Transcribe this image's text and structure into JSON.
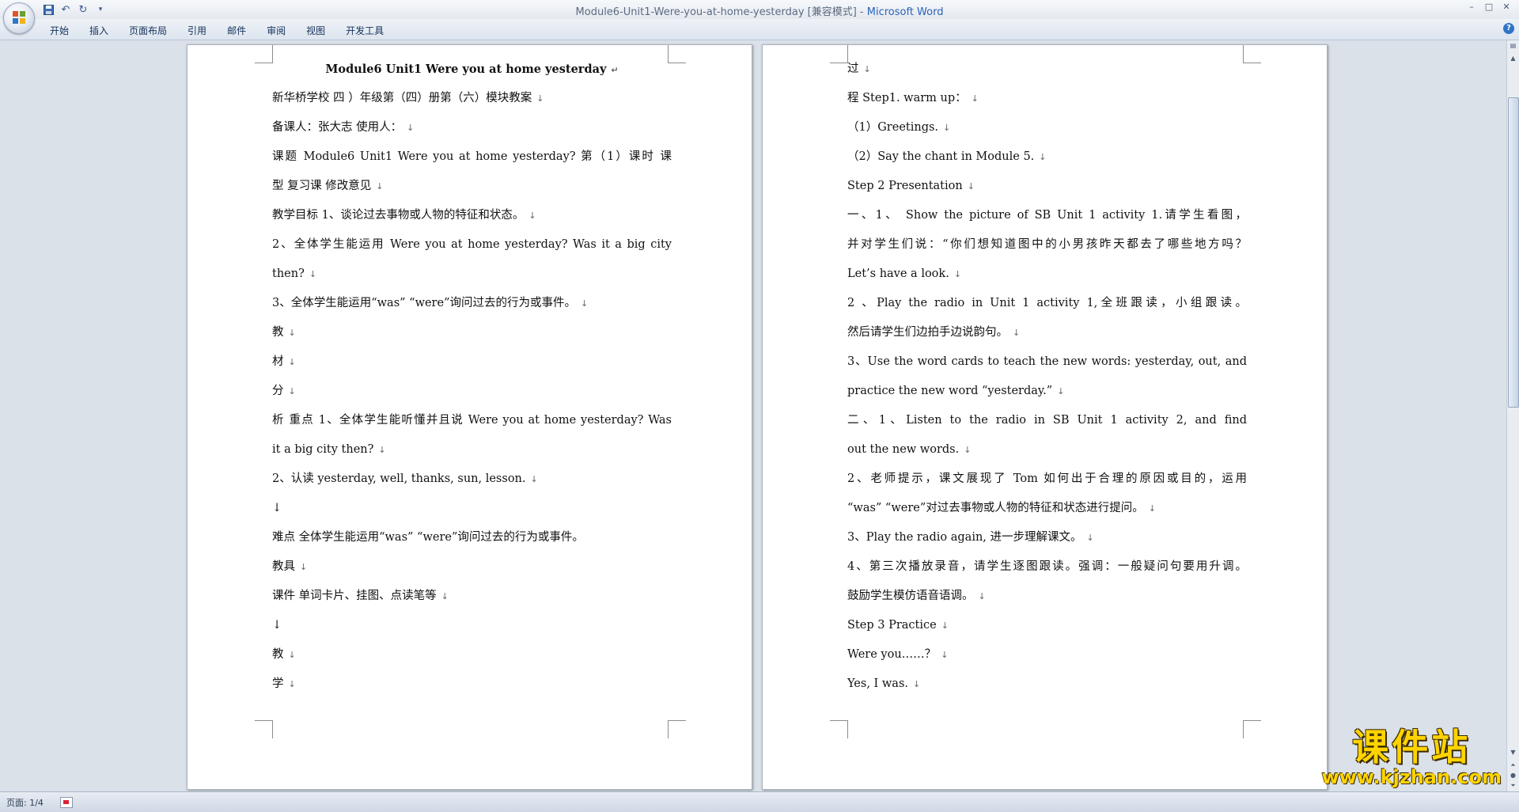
{
  "window": {
    "title": "Module6-Unit1-Were-you-at-home-yesterday [兼容模式] - ",
    "app_name": "Microsoft Word",
    "controls": [
      "–",
      "□",
      "✕"
    ]
  },
  "ribbon": {
    "tabs": [
      "开始",
      "插入",
      "页面布局",
      "引用",
      "邮件",
      "审阅",
      "视图",
      "开发工具"
    ],
    "help": "?"
  },
  "page_left": {
    "lines": [
      {
        "text": "Module6 Unit1 Were you at home yesterday",
        "style": "h",
        "mark": "↵"
      },
      {
        "text": "新华桥学校  四 ）年级第（四）册第（六）模块教案",
        "mark": "↓"
      },
      {
        "text": "备课人：张大志 使用人：",
        "mark": "↓"
      },
      {
        "text": "课题 Module6 Unit1 Were you at home yesterday? 第（1）课时 课",
        "style": "just"
      },
      {
        "text": "型 复习课 修改意见",
        "mark": "↓"
      },
      {
        "text": "教学目标 1、谈论过去事物或人物的特征和状态。",
        "mark": "↓"
      },
      {
        "text": "2、全体学生能运用 Were you at home yesterday? Was it a big city",
        "style": "just"
      },
      {
        "text": "then?",
        "mark": "↓"
      },
      {
        "text": "3、全体学生能运用“was” “were”询问过去的行为或事件。",
        "mark": "↓"
      },
      {
        "text": "教",
        "mark": "↓"
      },
      {
        "text": "材",
        "mark": "↓"
      },
      {
        "text": "分",
        "mark": "↓"
      },
      {
        "text": "析 重点 1、全体学生能听懂并且说 Were you at home yesterday? Was",
        "style": "just"
      },
      {
        "text": "it a big city then?",
        "mark": "↓"
      },
      {
        "text": "2、认读 yesterday, well, thanks, sun, lesson.",
        "mark": "↓"
      },
      {
        "text": "↓"
      },
      {
        "text": "难点 全体学生能运用“was” “were”询问过去的行为或事件。"
      },
      {
        "text": "教具",
        "mark": "↓"
      },
      {
        "text": "课件 单词卡片、挂图、点读笔等",
        "mark": "↓"
      },
      {
        "text": "↓"
      },
      {
        "text": "教",
        "mark": "↓"
      },
      {
        "text": "学",
        "mark": "↓"
      }
    ]
  },
  "page_right": {
    "lines": [
      {
        "text": "过",
        "mark": "↓"
      },
      {
        "text": "程 Step1. warm up：",
        "mark": "↓"
      },
      {
        "text": "（1）Greetings.",
        "mark": "↓"
      },
      {
        "text": "（2）Say the chant in Module 5.",
        "mark": "↓"
      },
      {
        "text": "Step 2 Presentation",
        "mark": "↓"
      },
      {
        "text": "一、1、 Show the picture of SB Unit 1 activity 1.请学生看图，",
        "style": "just"
      },
      {
        "text": "并对学生们说：“你们想知道图中的小男孩昨天都去了哪些地方吗？",
        "style": "just"
      },
      {
        "text": "Let’s have a look.",
        "mark": "↓"
      },
      {
        "text": "2 、Play the radio in Unit 1 activity 1,全班跟读，小组跟读。",
        "style": "just"
      },
      {
        "text": "然后请学生们边拍手边说韵句。",
        "mark": "↓"
      },
      {
        "text": "3、Use the word cards to teach the new words: yesterday, out, and",
        "style": "just"
      },
      {
        "text": "practice the new word “yesterday.”",
        "mark": "↓"
      },
      {
        "text": "二、1、Listen to the radio in SB Unit 1 activity 2, and find",
        "style": "just"
      },
      {
        "text": "out the new words.",
        "mark": "↓"
      },
      {
        "text": "2、老师提示，课文展现了 Tom 如何出于合理的原因或目的，运用",
        "style": "just"
      },
      {
        "text": "“was” “were”对过去事物或人物的特征和状态进行提问。",
        "mark": "↓"
      },
      {
        "text": "3、Play the radio again, 进一步理解课文。",
        "mark": "↓"
      },
      {
        "text": "4、第三次播放录音，请学生逐图跟读。强调：一般疑问句要用升调。",
        "style": "just"
      },
      {
        "text": "鼓励学生模仿语音语调。",
        "mark": "↓"
      },
      {
        "text": "Step 3 Practice",
        "mark": "↓"
      },
      {
        "text": "Were you……？",
        "mark": "↓"
      },
      {
        "text": "Yes, I was.",
        "mark": "↓"
      }
    ]
  },
  "status": {
    "page_info": "页面: 1/4"
  },
  "watermark": {
    "cn": "课件站",
    "url": "www.kjzhan.com"
  }
}
